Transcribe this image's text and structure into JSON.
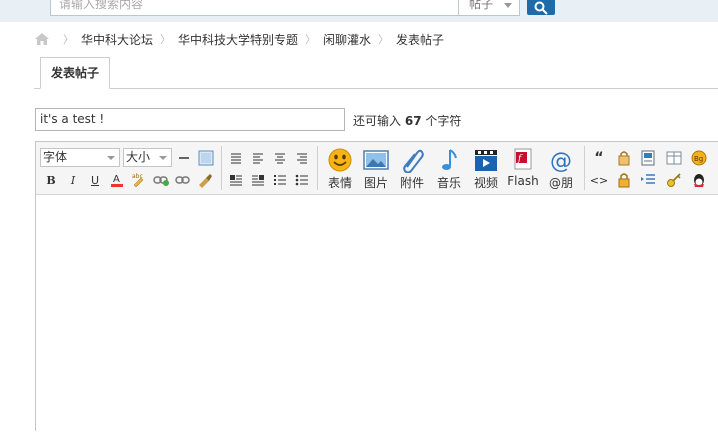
{
  "search": {
    "placeholder": "请输入搜索内容",
    "type": "帖子"
  },
  "breadcrumb": [
    "华中科大论坛",
    "华中科技大学特别专题",
    "闲聊灌水",
    "发表帖子"
  ],
  "tab": {
    "label": "发表帖子"
  },
  "subject": {
    "value": "it's a test !"
  },
  "remain": {
    "prefix": "还可输入",
    "count": "67",
    "suffix": "个字符"
  },
  "editor": {
    "font_select": "字体",
    "size_select": "大小",
    "big_buttons": [
      "表情",
      "图片",
      "附件",
      "音乐",
      "视频",
      "Flash",
      "@朋"
    ],
    "small_glyphs": {
      "bold": "B",
      "italic": "I",
      "underline": "U",
      "quote": "“",
      "code": "<>"
    }
  }
}
